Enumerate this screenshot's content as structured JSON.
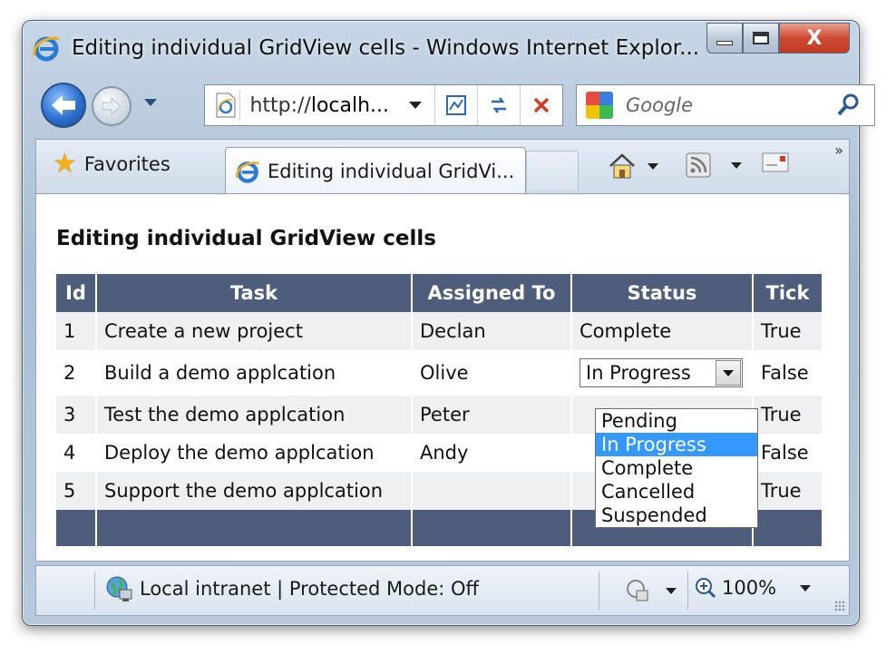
{
  "window": {
    "title": "Editing individual GridView cells - Windows Internet Explor...",
    "close_label": "X"
  },
  "nav": {
    "address": "http://localh...",
    "address_prefix": "http://",
    "address_host": "localh...",
    "search_placeholder": "Google",
    "refresh_icon": "refresh-icon",
    "stop_icon": "stop-icon"
  },
  "tabs": {
    "favorites_label": "Favorites",
    "active_tab_label": "Editing individual GridVi...",
    "overflow_label": "»"
  },
  "page": {
    "title": "Editing individual GridView cells"
  },
  "grid": {
    "columns": [
      "Id",
      "Task",
      "Assigned To",
      "Status",
      "Tick"
    ],
    "rows": [
      {
        "id": "1",
        "task": "Create a new project",
        "assigned": "Declan",
        "status": "Complete",
        "tick": "True"
      },
      {
        "id": "2",
        "task": "Build a demo applcation",
        "assigned": "Olive",
        "status": "In Progress",
        "tick": "False"
      },
      {
        "id": "3",
        "task": "Test the demo applcation",
        "assigned": "Peter",
        "status": "",
        "tick": "True"
      },
      {
        "id": "4",
        "task": "Deploy the demo applcation",
        "assigned": "Andy",
        "status": "",
        "tick": "False"
      },
      {
        "id": "5",
        "task": "Support the demo applcation",
        "assigned": "",
        "status": "",
        "tick": "True"
      }
    ],
    "status_options": [
      "Pending",
      "In Progress",
      "Complete",
      "Cancelled",
      "Suspended"
    ],
    "status_selected": "In Progress"
  },
  "statusbar": {
    "zone": "Local intranet | Protected Mode: Off",
    "zoom": "100%"
  },
  "colors": {
    "header_bg": "#4d5d7b",
    "alt_row": "#eef0f2",
    "selected_option": "#3399ff"
  }
}
